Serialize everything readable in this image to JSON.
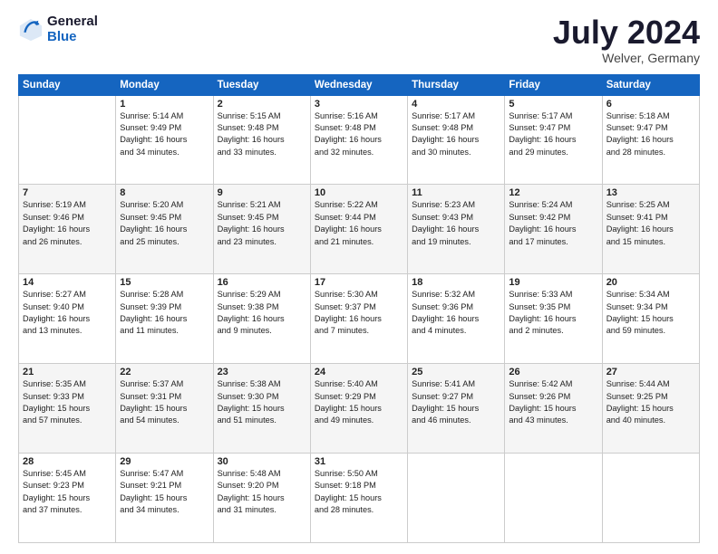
{
  "logo": {
    "text_general": "General",
    "text_blue": "Blue"
  },
  "title": "July 2024",
  "subtitle": "Welver, Germany",
  "header_days": [
    "Sunday",
    "Monday",
    "Tuesday",
    "Wednesday",
    "Thursday",
    "Friday",
    "Saturday"
  ],
  "weeks": [
    [
      {
        "day": "",
        "info": ""
      },
      {
        "day": "1",
        "info": "Sunrise: 5:14 AM\nSunset: 9:49 PM\nDaylight: 16 hours\nand 34 minutes."
      },
      {
        "day": "2",
        "info": "Sunrise: 5:15 AM\nSunset: 9:48 PM\nDaylight: 16 hours\nand 33 minutes."
      },
      {
        "day": "3",
        "info": "Sunrise: 5:16 AM\nSunset: 9:48 PM\nDaylight: 16 hours\nand 32 minutes."
      },
      {
        "day": "4",
        "info": "Sunrise: 5:17 AM\nSunset: 9:48 PM\nDaylight: 16 hours\nand 30 minutes."
      },
      {
        "day": "5",
        "info": "Sunrise: 5:17 AM\nSunset: 9:47 PM\nDaylight: 16 hours\nand 29 minutes."
      },
      {
        "day": "6",
        "info": "Sunrise: 5:18 AM\nSunset: 9:47 PM\nDaylight: 16 hours\nand 28 minutes."
      }
    ],
    [
      {
        "day": "7",
        "info": "Sunrise: 5:19 AM\nSunset: 9:46 PM\nDaylight: 16 hours\nand 26 minutes."
      },
      {
        "day": "8",
        "info": "Sunrise: 5:20 AM\nSunset: 9:45 PM\nDaylight: 16 hours\nand 25 minutes."
      },
      {
        "day": "9",
        "info": "Sunrise: 5:21 AM\nSunset: 9:45 PM\nDaylight: 16 hours\nand 23 minutes."
      },
      {
        "day": "10",
        "info": "Sunrise: 5:22 AM\nSunset: 9:44 PM\nDaylight: 16 hours\nand 21 minutes."
      },
      {
        "day": "11",
        "info": "Sunrise: 5:23 AM\nSunset: 9:43 PM\nDaylight: 16 hours\nand 19 minutes."
      },
      {
        "day": "12",
        "info": "Sunrise: 5:24 AM\nSunset: 9:42 PM\nDaylight: 16 hours\nand 17 minutes."
      },
      {
        "day": "13",
        "info": "Sunrise: 5:25 AM\nSunset: 9:41 PM\nDaylight: 16 hours\nand 15 minutes."
      }
    ],
    [
      {
        "day": "14",
        "info": "Sunrise: 5:27 AM\nSunset: 9:40 PM\nDaylight: 16 hours\nand 13 minutes."
      },
      {
        "day": "15",
        "info": "Sunrise: 5:28 AM\nSunset: 9:39 PM\nDaylight: 16 hours\nand 11 minutes."
      },
      {
        "day": "16",
        "info": "Sunrise: 5:29 AM\nSunset: 9:38 PM\nDaylight: 16 hours\nand 9 minutes."
      },
      {
        "day": "17",
        "info": "Sunrise: 5:30 AM\nSunset: 9:37 PM\nDaylight: 16 hours\nand 7 minutes."
      },
      {
        "day": "18",
        "info": "Sunrise: 5:32 AM\nSunset: 9:36 PM\nDaylight: 16 hours\nand 4 minutes."
      },
      {
        "day": "19",
        "info": "Sunrise: 5:33 AM\nSunset: 9:35 PM\nDaylight: 16 hours\nand 2 minutes."
      },
      {
        "day": "20",
        "info": "Sunrise: 5:34 AM\nSunset: 9:34 PM\nDaylight: 15 hours\nand 59 minutes."
      }
    ],
    [
      {
        "day": "21",
        "info": "Sunrise: 5:35 AM\nSunset: 9:33 PM\nDaylight: 15 hours\nand 57 minutes."
      },
      {
        "day": "22",
        "info": "Sunrise: 5:37 AM\nSunset: 9:31 PM\nDaylight: 15 hours\nand 54 minutes."
      },
      {
        "day": "23",
        "info": "Sunrise: 5:38 AM\nSunset: 9:30 PM\nDaylight: 15 hours\nand 51 minutes."
      },
      {
        "day": "24",
        "info": "Sunrise: 5:40 AM\nSunset: 9:29 PM\nDaylight: 15 hours\nand 49 minutes."
      },
      {
        "day": "25",
        "info": "Sunrise: 5:41 AM\nSunset: 9:27 PM\nDaylight: 15 hours\nand 46 minutes."
      },
      {
        "day": "26",
        "info": "Sunrise: 5:42 AM\nSunset: 9:26 PM\nDaylight: 15 hours\nand 43 minutes."
      },
      {
        "day": "27",
        "info": "Sunrise: 5:44 AM\nSunset: 9:25 PM\nDaylight: 15 hours\nand 40 minutes."
      }
    ],
    [
      {
        "day": "28",
        "info": "Sunrise: 5:45 AM\nSunset: 9:23 PM\nDaylight: 15 hours\nand 37 minutes."
      },
      {
        "day": "29",
        "info": "Sunrise: 5:47 AM\nSunset: 9:21 PM\nDaylight: 15 hours\nand 34 minutes."
      },
      {
        "day": "30",
        "info": "Sunrise: 5:48 AM\nSunset: 9:20 PM\nDaylight: 15 hours\nand 31 minutes."
      },
      {
        "day": "31",
        "info": "Sunrise: 5:50 AM\nSunset: 9:18 PM\nDaylight: 15 hours\nand 28 minutes."
      },
      {
        "day": "",
        "info": ""
      },
      {
        "day": "",
        "info": ""
      },
      {
        "day": "",
        "info": ""
      }
    ]
  ]
}
